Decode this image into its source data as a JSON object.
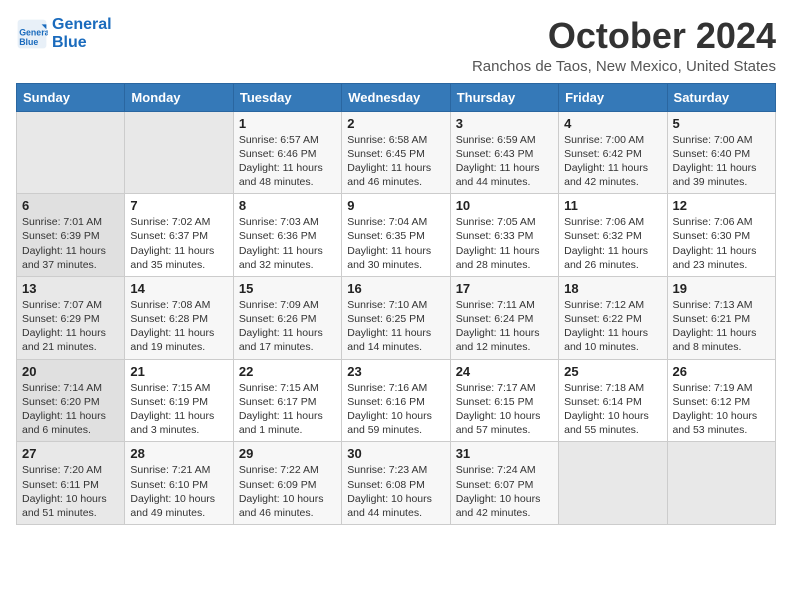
{
  "header": {
    "logo_line1": "General",
    "logo_line2": "Blue",
    "month": "October 2024",
    "location": "Ranchos de Taos, New Mexico, United States"
  },
  "weekdays": [
    "Sunday",
    "Monday",
    "Tuesday",
    "Wednesday",
    "Thursday",
    "Friday",
    "Saturday"
  ],
  "weeks": [
    [
      {
        "day": "",
        "info": ""
      },
      {
        "day": "",
        "info": ""
      },
      {
        "day": "1",
        "info": "Sunrise: 6:57 AM\nSunset: 6:46 PM\nDaylight: 11 hours and 48 minutes."
      },
      {
        "day": "2",
        "info": "Sunrise: 6:58 AM\nSunset: 6:45 PM\nDaylight: 11 hours and 46 minutes."
      },
      {
        "day": "3",
        "info": "Sunrise: 6:59 AM\nSunset: 6:43 PM\nDaylight: 11 hours and 44 minutes."
      },
      {
        "day": "4",
        "info": "Sunrise: 7:00 AM\nSunset: 6:42 PM\nDaylight: 11 hours and 42 minutes."
      },
      {
        "day": "5",
        "info": "Sunrise: 7:00 AM\nSunset: 6:40 PM\nDaylight: 11 hours and 39 minutes."
      }
    ],
    [
      {
        "day": "6",
        "info": "Sunrise: 7:01 AM\nSunset: 6:39 PM\nDaylight: 11 hours and 37 minutes."
      },
      {
        "day": "7",
        "info": "Sunrise: 7:02 AM\nSunset: 6:37 PM\nDaylight: 11 hours and 35 minutes."
      },
      {
        "day": "8",
        "info": "Sunrise: 7:03 AM\nSunset: 6:36 PM\nDaylight: 11 hours and 32 minutes."
      },
      {
        "day": "9",
        "info": "Sunrise: 7:04 AM\nSunset: 6:35 PM\nDaylight: 11 hours and 30 minutes."
      },
      {
        "day": "10",
        "info": "Sunrise: 7:05 AM\nSunset: 6:33 PM\nDaylight: 11 hours and 28 minutes."
      },
      {
        "day": "11",
        "info": "Sunrise: 7:06 AM\nSunset: 6:32 PM\nDaylight: 11 hours and 26 minutes."
      },
      {
        "day": "12",
        "info": "Sunrise: 7:06 AM\nSunset: 6:30 PM\nDaylight: 11 hours and 23 minutes."
      }
    ],
    [
      {
        "day": "13",
        "info": "Sunrise: 7:07 AM\nSunset: 6:29 PM\nDaylight: 11 hours and 21 minutes."
      },
      {
        "day": "14",
        "info": "Sunrise: 7:08 AM\nSunset: 6:28 PM\nDaylight: 11 hours and 19 minutes."
      },
      {
        "day": "15",
        "info": "Sunrise: 7:09 AM\nSunset: 6:26 PM\nDaylight: 11 hours and 17 minutes."
      },
      {
        "day": "16",
        "info": "Sunrise: 7:10 AM\nSunset: 6:25 PM\nDaylight: 11 hours and 14 minutes."
      },
      {
        "day": "17",
        "info": "Sunrise: 7:11 AM\nSunset: 6:24 PM\nDaylight: 11 hours and 12 minutes."
      },
      {
        "day": "18",
        "info": "Sunrise: 7:12 AM\nSunset: 6:22 PM\nDaylight: 11 hours and 10 minutes."
      },
      {
        "day": "19",
        "info": "Sunrise: 7:13 AM\nSunset: 6:21 PM\nDaylight: 11 hours and 8 minutes."
      }
    ],
    [
      {
        "day": "20",
        "info": "Sunrise: 7:14 AM\nSunset: 6:20 PM\nDaylight: 11 hours and 6 minutes."
      },
      {
        "day": "21",
        "info": "Sunrise: 7:15 AM\nSunset: 6:19 PM\nDaylight: 11 hours and 3 minutes."
      },
      {
        "day": "22",
        "info": "Sunrise: 7:15 AM\nSunset: 6:17 PM\nDaylight: 11 hours and 1 minute."
      },
      {
        "day": "23",
        "info": "Sunrise: 7:16 AM\nSunset: 6:16 PM\nDaylight: 10 hours and 59 minutes."
      },
      {
        "day": "24",
        "info": "Sunrise: 7:17 AM\nSunset: 6:15 PM\nDaylight: 10 hours and 57 minutes."
      },
      {
        "day": "25",
        "info": "Sunrise: 7:18 AM\nSunset: 6:14 PM\nDaylight: 10 hours and 55 minutes."
      },
      {
        "day": "26",
        "info": "Sunrise: 7:19 AM\nSunset: 6:12 PM\nDaylight: 10 hours and 53 minutes."
      }
    ],
    [
      {
        "day": "27",
        "info": "Sunrise: 7:20 AM\nSunset: 6:11 PM\nDaylight: 10 hours and 51 minutes."
      },
      {
        "day": "28",
        "info": "Sunrise: 7:21 AM\nSunset: 6:10 PM\nDaylight: 10 hours and 49 minutes."
      },
      {
        "day": "29",
        "info": "Sunrise: 7:22 AM\nSunset: 6:09 PM\nDaylight: 10 hours and 46 minutes."
      },
      {
        "day": "30",
        "info": "Sunrise: 7:23 AM\nSunset: 6:08 PM\nDaylight: 10 hours and 44 minutes."
      },
      {
        "day": "31",
        "info": "Sunrise: 7:24 AM\nSunset: 6:07 PM\nDaylight: 10 hours and 42 minutes."
      },
      {
        "day": "",
        "info": ""
      },
      {
        "day": "",
        "info": ""
      }
    ]
  ]
}
